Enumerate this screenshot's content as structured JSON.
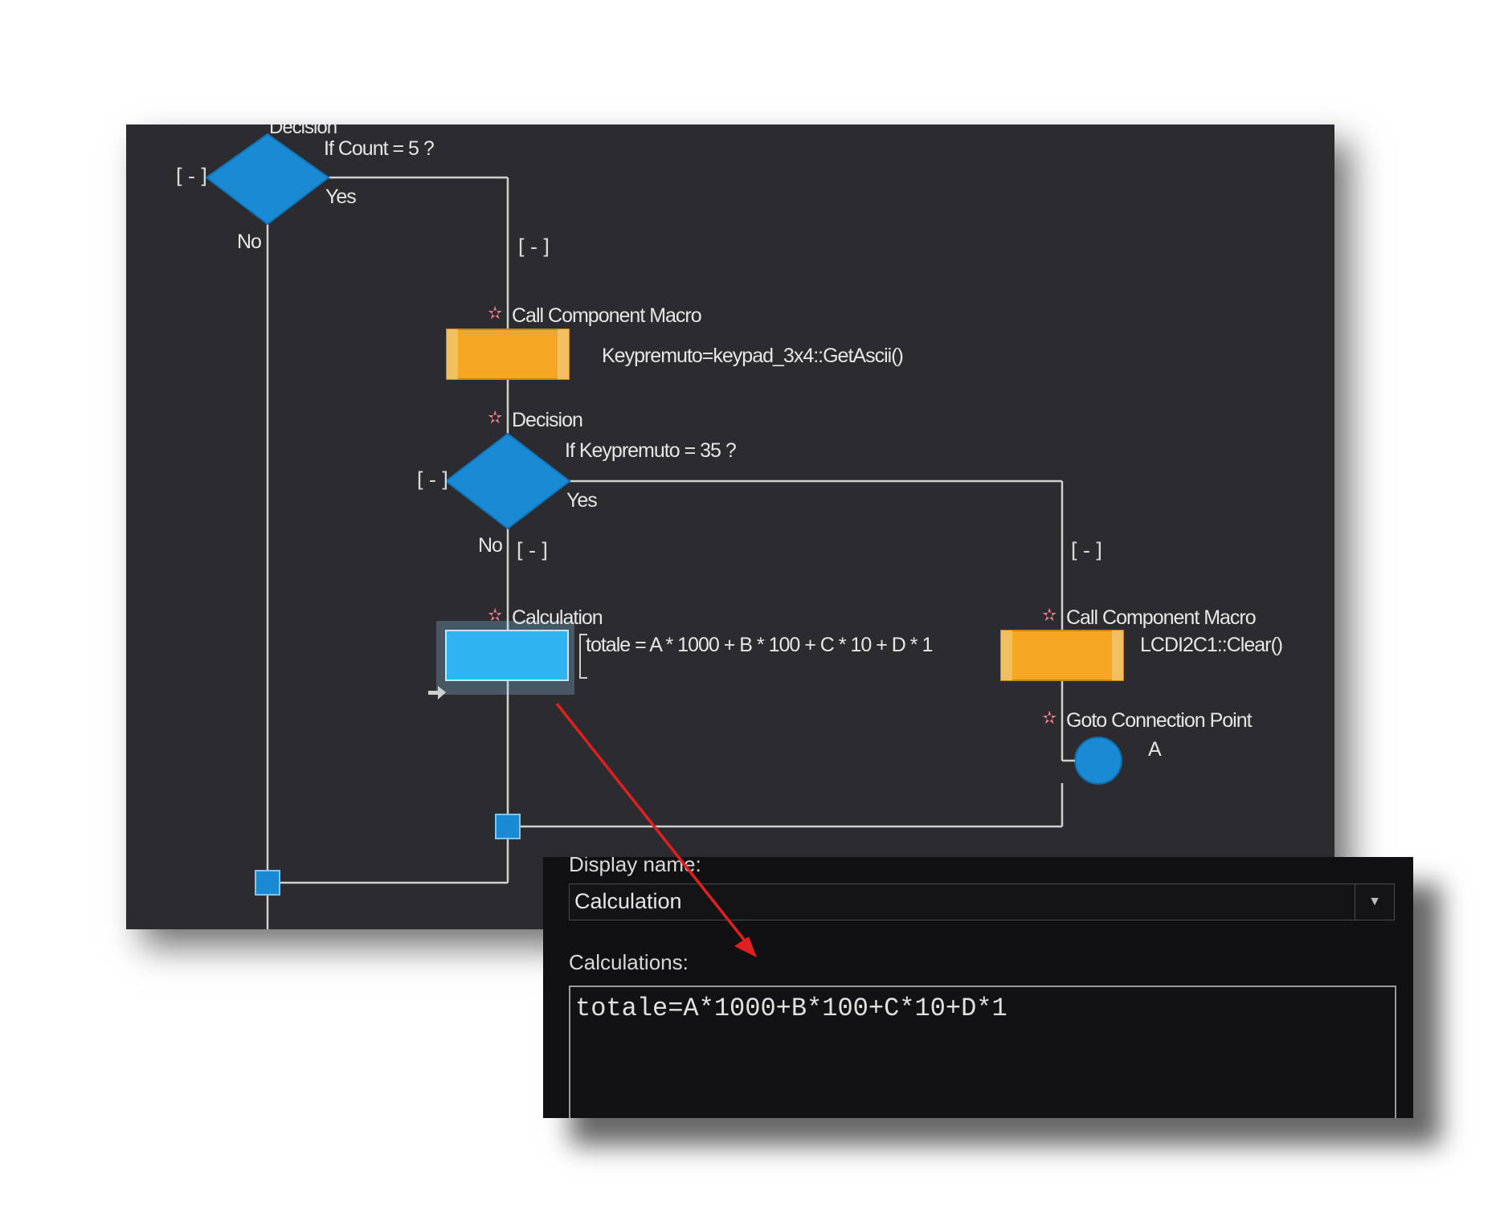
{
  "flowchart": {
    "decision1": {
      "partial_title": "Decision",
      "condition": "If Count = 5 ?",
      "yes_label": "Yes",
      "no_label": "No",
      "collapse_toggle": "[-]",
      "yes_branch_toggle": "[-]"
    },
    "macro1": {
      "title": "Call Component Macro",
      "detail": "Keypremuto=keypad_3x4::GetAscii()"
    },
    "decision2": {
      "title": "Decision",
      "condition": "If Keypremuto = 35 ?",
      "yes_label": "Yes",
      "no_label": "No",
      "collapse_toggle": "[-]",
      "no_branch_toggle": "[-]",
      "yes_branch_toggle": "[-]"
    },
    "calculation": {
      "title": "Calculation",
      "detail": "totale = A * 1000 + B * 100 + C * 10 + D * 1"
    },
    "macro2": {
      "title": "Call Component Macro",
      "detail": "LCDI2C1::Clear()"
    },
    "goto": {
      "title": "Goto Connection Point",
      "point": "A"
    },
    "colors": {
      "canvas": "#2c2c30",
      "decision": "#1a8ad4",
      "macro": "#f5a623",
      "calculation": "#2fb4f0",
      "connector": "#d0d0d0",
      "pointer_arrow": "#e02020"
    }
  },
  "properties": {
    "display_name_label": "Display name:",
    "display_name_value": "Calculation",
    "calculations_label": "Calculations:",
    "calculations_value": "totale=A*1000+B*100+C*10+D*1"
  },
  "icons": [
    "star-icon",
    "dropdown-arrow-icon",
    "entry-arrow-icon",
    "connection-point-icon"
  ]
}
